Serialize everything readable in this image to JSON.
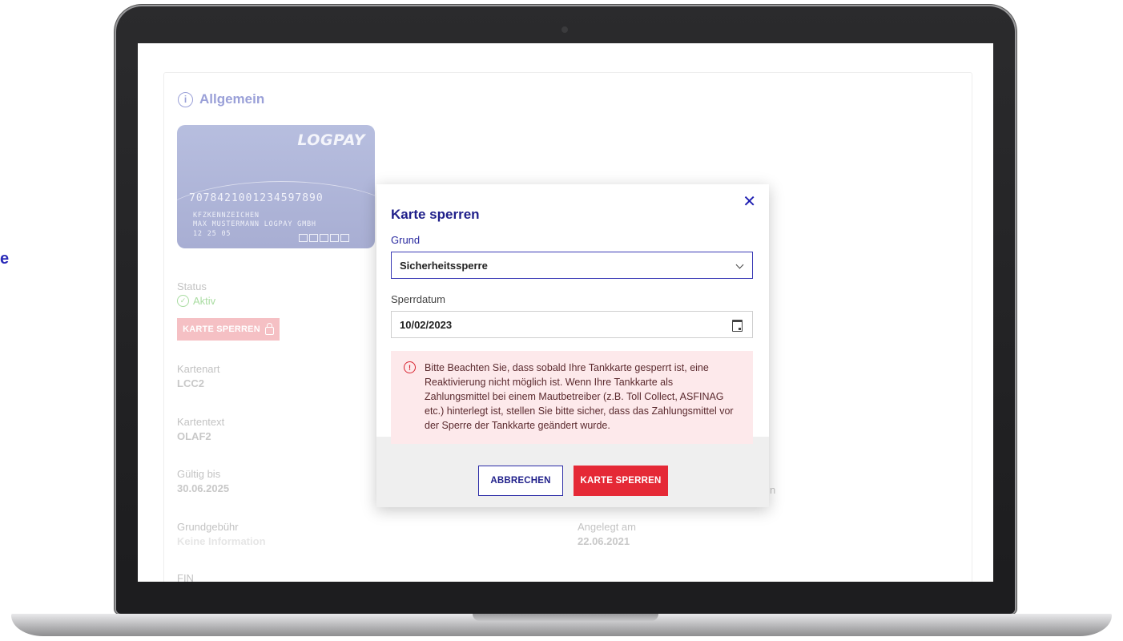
{
  "side_fragment": "e",
  "section": {
    "title": "Allgemein",
    "icon": "info-icon"
  },
  "card": {
    "logo": "LOGPAY",
    "number": "7078421001234597890",
    "line1": "KFZKENNZEICHEN",
    "line2": "MAX MUSTERMANN LOGPAY GMBH",
    "line3": "12 25       05"
  },
  "fields": {
    "status_label": "Status",
    "status_value": "Aktiv",
    "block_button": "KARTE SPERREN",
    "kartenart_label": "Kartenart",
    "kartenart_value": "LCC2",
    "kartentext_label": "Kartentext",
    "kartentext_value": "OLAF2",
    "gueltig_label": "Gültig bis",
    "gueltig_value": "30.06.2025",
    "grundgebuehr_label": "Grundgebühr",
    "grundgebuehr_value": "Keine Information",
    "fin_label": "FIN",
    "angelegt_label": "Angelegt am",
    "angelegt_value": "22.06.2021",
    "partial_right": "n"
  },
  "modal": {
    "title": "Karte sperren",
    "close_icon": "close-icon",
    "grund_label": "Grund",
    "grund_value": "Sicherheitssperre",
    "sperrdatum_label": "Sperrdatum",
    "sperrdatum_value": "10/02/2023",
    "warning": "Bitte Beachten Sie, dass sobald Ihre Tankkarte gesperrt ist, eine Reaktivierung nicht möglich ist. Wenn Ihre Tankkarte als Zahlungsmittel bei einem Mautbetreiber (z.B. Toll Collect, ASFINAG etc.) hinterlegt ist, stellen Sie bitte sicher, dass das Zahlungsmittel vor der Sperre der Tankkarte geändert wurde.",
    "cancel_label": "ABBRECHEN",
    "confirm_label": "KARTE SPERREN"
  },
  "colors": {
    "brand_blue": "#1f1f8a",
    "danger_red": "#e52936",
    "warning_bg": "#fde9eb"
  }
}
